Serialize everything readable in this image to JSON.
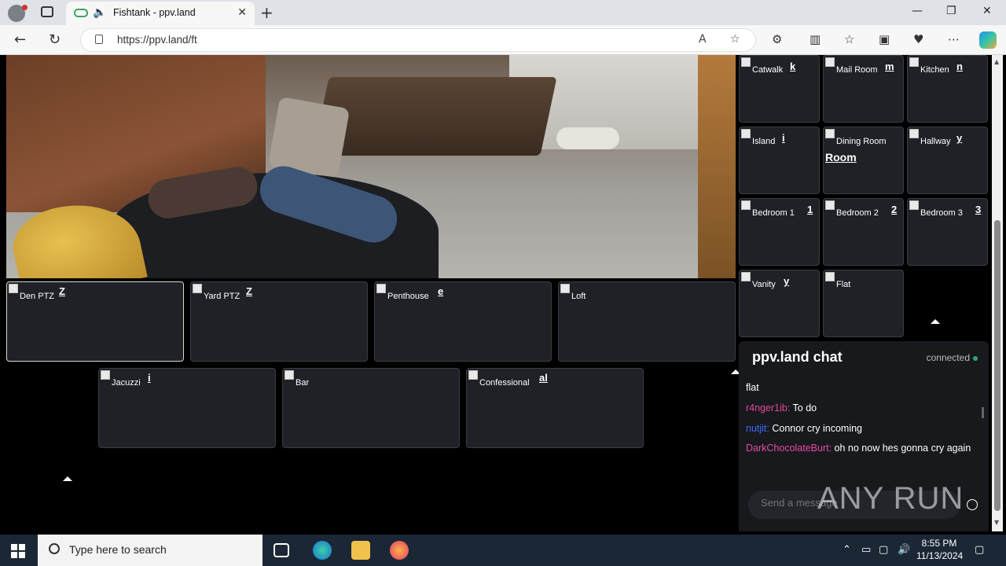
{
  "browser": {
    "tab_title": "Fishtank - ppv.land",
    "url": "https://ppv.land/ft"
  },
  "rooms_top": [
    {
      "label": "Catwalk",
      "ghost": "k"
    },
    {
      "label": "Mail Room",
      "ghost": "m"
    },
    {
      "label": "Kitchen",
      "ghost": "n"
    },
    {
      "label": "Island",
      "ghost": "i"
    },
    {
      "label": "Dining Room",
      "ghost": "Room"
    },
    {
      "label": "Hallway",
      "ghost": "y"
    },
    {
      "label": "Bedroom 1",
      "ghost": "1"
    },
    {
      "label": "Bedroom 2",
      "ghost": "2"
    },
    {
      "label": "Bedroom 3",
      "ghost": "3"
    },
    {
      "label": "Vanity",
      "ghost": "y"
    },
    {
      "label": "Flat",
      "ghost": ""
    }
  ],
  "rooms_bottom": [
    {
      "label": "Den PTZ",
      "ghost": "Z"
    },
    {
      "label": "Yard PTZ",
      "ghost": "Z"
    },
    {
      "label": "Penthouse",
      "ghost": "e"
    },
    {
      "label": "Loft",
      "ghost": ""
    },
    {
      "label": "Jacuzzi",
      "ghost": "i"
    },
    {
      "label": "Bar",
      "ghost": ""
    },
    {
      "label": "Confessional",
      "ghost": "al"
    }
  ],
  "chat": {
    "title": "ppv.land chat",
    "status": "connected",
    "status_color": "#2ea86a",
    "messages": [
      {
        "user": "",
        "text": "flat"
      },
      {
        "user": "r4nger1ib:",
        "text": " To do"
      },
      {
        "user": "nutjit:",
        "text": " Connor cry incoming"
      },
      {
        "user": "DarkChocolateBurt:",
        "text": " oh no now hes gonna cry again"
      }
    ],
    "input_placeholder": "Send a message"
  },
  "watermark": "ANY RUN",
  "taskbar": {
    "search_placeholder": "Type here to search",
    "time": "8:55 PM",
    "date": "11/13/2024"
  }
}
